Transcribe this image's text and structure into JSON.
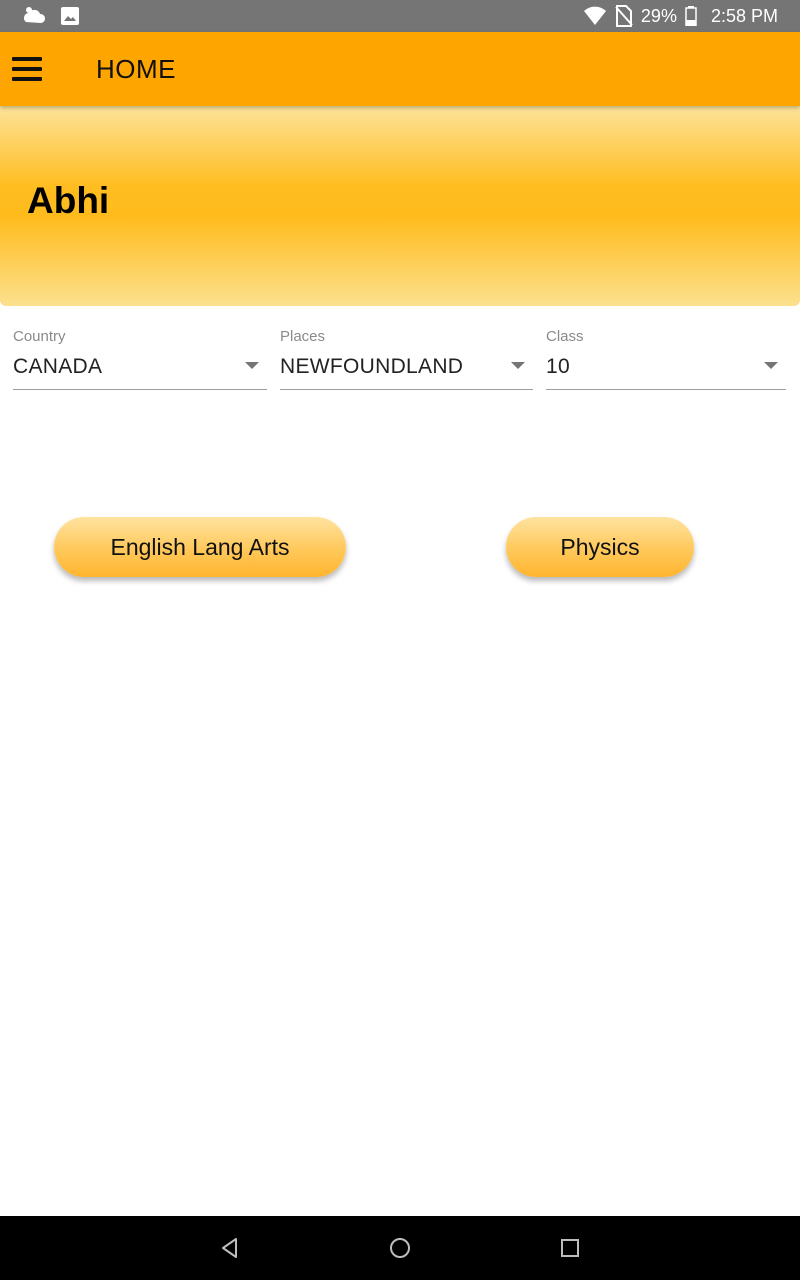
{
  "status_bar": {
    "notification_icons": [
      "weather-icon",
      "image-icon"
    ],
    "battery_percent": "29%",
    "time": "2:58 PM"
  },
  "app_bar": {
    "title": "HOME",
    "menu_icon": "hamburger-menu-icon"
  },
  "banner": {
    "name": "Abhi"
  },
  "filters": {
    "country": {
      "label": "Country",
      "value": "CANADA"
    },
    "places": {
      "label": "Places",
      "value": "NEWFOUNDLAND"
    },
    "class": {
      "label": "Class",
      "value": "10"
    }
  },
  "subjects": [
    {
      "label": "English Lang Arts"
    },
    {
      "label": "Physics"
    }
  ],
  "nav_bar": {
    "icons": [
      "back-icon",
      "home-icon",
      "recents-icon"
    ]
  },
  "colors": {
    "app_bar": "#ffa500",
    "banner_mid": "#ffbb1c",
    "status_bar": "#757575",
    "nav_bar": "#000000"
  }
}
